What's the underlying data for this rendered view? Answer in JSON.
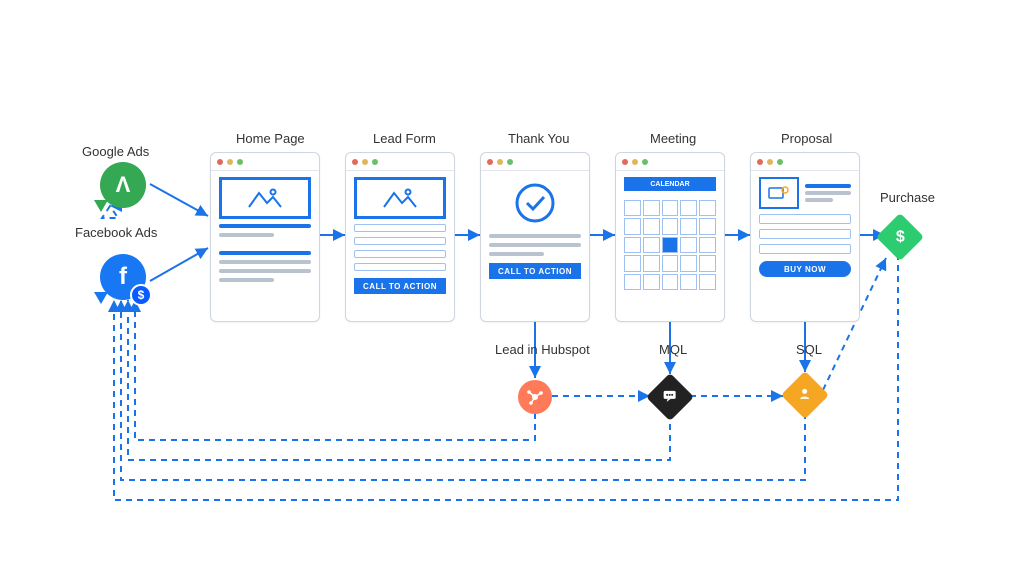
{
  "sources": {
    "google": {
      "label": "Google Ads"
    },
    "facebook": {
      "label": "Facebook Ads"
    }
  },
  "steps": {
    "home": {
      "title": "Home Page",
      "cta": ""
    },
    "lead": {
      "title": "Lead Form",
      "cta": "CALL TO ACTION"
    },
    "thank": {
      "title": "Thank You",
      "cta": "CALL TO ACTION"
    },
    "meeting": {
      "title": "Meeting",
      "calendar_label": "CALENDAR"
    },
    "proposal": {
      "title": "Proposal",
      "cta": "BUY NOW"
    }
  },
  "outcomes": {
    "hubspot": {
      "label": "Lead in Hubspot"
    },
    "mql": {
      "label": "MQL"
    },
    "sql": {
      "label": "SQL"
    },
    "purchase": {
      "label": "Purchase",
      "glyph": "$"
    }
  },
  "colors": {
    "primary": "#1a73e8",
    "google_green": "#34a853",
    "facebook_blue": "#1877f2",
    "hubspot_orange": "#ff7a59",
    "mql_dark": "#222",
    "sql_amber": "#f5a623",
    "purchase_green": "#2ecc71"
  }
}
